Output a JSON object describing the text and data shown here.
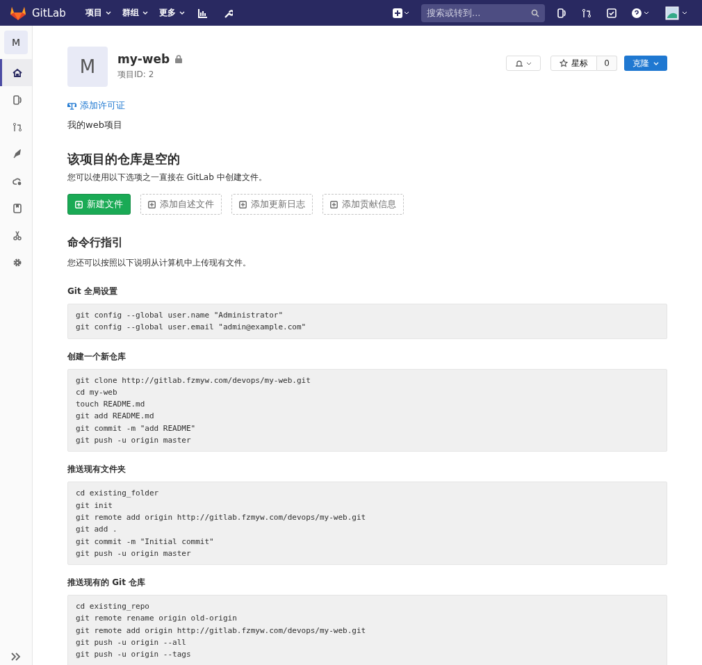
{
  "navbar": {
    "brand": "GitLab",
    "menus": [
      {
        "label": "项目"
      },
      {
        "label": "群组"
      },
      {
        "label": "更多"
      }
    ],
    "search": {
      "placeholder": "搜索或转到..."
    }
  },
  "sidebar": {
    "avatar": "M",
    "items": [
      {
        "selected": true
      },
      {
        "selected": false
      },
      {
        "selected": false
      },
      {
        "selected": false
      },
      {
        "selected": false
      },
      {
        "selected": false
      },
      {
        "selected": false
      },
      {
        "selected": false
      }
    ]
  },
  "project": {
    "avatar": "M",
    "name": "my-web",
    "id_label": "项目ID: 2",
    "star_label": "星标",
    "star_count": "0",
    "clone_label": "克隆",
    "license_link": "添加许可证",
    "description": "我的web项目"
  },
  "empty": {
    "title": "该项目的仓库是空的",
    "text": "您可以使用以下选项之一直接在 GitLab 中创建文件。",
    "buttons": [
      {
        "label": "新建文件",
        "kind": "primary"
      },
      {
        "label": "添加自述文件",
        "kind": "dashed"
      },
      {
        "label": "添加更新日志",
        "kind": "dashed"
      },
      {
        "label": "添加贡献信息",
        "kind": "dashed"
      }
    ]
  },
  "cli": {
    "title": "命令行指引",
    "text": "您还可以按照以下说明从计算机中上传现有文件。",
    "sections": [
      {
        "title": "Git 全局设置",
        "lines": [
          "git config --global user.name \"Administrator\"",
          "git config --global user.email \"admin@example.com\""
        ]
      },
      {
        "title": "创建一个新仓库",
        "lines": [
          "git clone http://gitlab.fzmyw.com/devops/my-web.git",
          "cd my-web",
          "touch README.md",
          "git add README.md",
          "git commit -m \"add README\"",
          "git push -u origin master"
        ]
      },
      {
        "title": "推送现有文件夹",
        "lines": [
          "cd existing_folder",
          "git init",
          "git remote add origin http://gitlab.fzmyw.com/devops/my-web.git",
          "git add .",
          "git commit -m \"Initial commit\"",
          "git push -u origin master"
        ]
      },
      {
        "title": "推送现有的 Git 仓库",
        "lines": [
          "cd existing_repo",
          "git remote rename origin old-origin",
          "git remote add origin http://gitlab.fzmyw.com/devops/my-web.git",
          "git push -u origin --all",
          "git push -u origin --tags"
        ]
      }
    ]
  }
}
